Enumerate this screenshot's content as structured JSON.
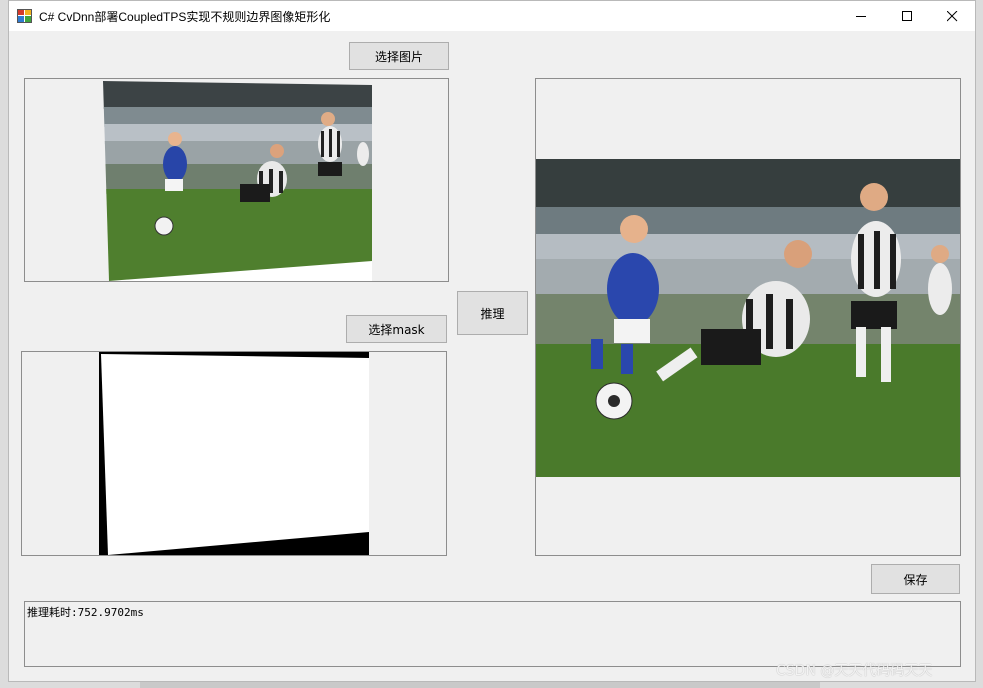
{
  "window": {
    "title": "C# CvDnn部署CoupledTPS实现不规则边界图像矩形化"
  },
  "buttons": {
    "select_image": "选择图片",
    "select_mask": "选择mask",
    "infer": "推理",
    "save": "保存"
  },
  "status": {
    "text": "推理耗时:752.9702ms"
  },
  "watermark": "CSDN @天天代码码天天",
  "colors": {
    "window_bg": "#f0f0f0",
    "button_bg": "#e1e1e1",
    "border": "#8d8d8d"
  }
}
